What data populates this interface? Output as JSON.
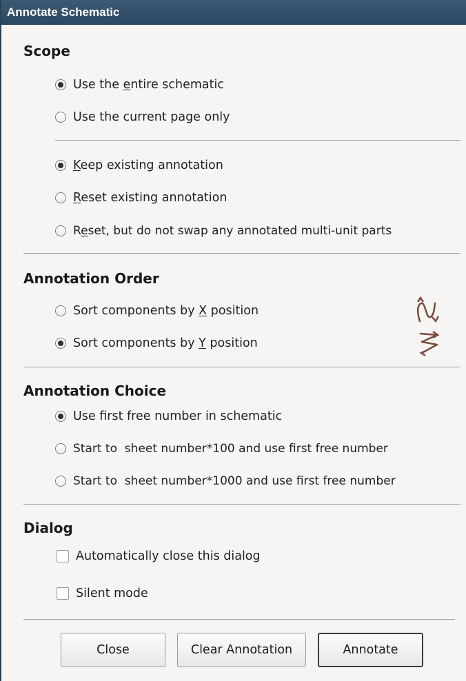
{
  "window": {
    "title": "Annotate Schematic"
  },
  "scope": {
    "title": "Scope",
    "options": [
      {
        "pre": "Use the ",
        "mn": "e",
        "post": "ntire schematic",
        "checked": true
      },
      {
        "pre": "Use the current page only",
        "mn": "",
        "post": "",
        "checked": false
      }
    ],
    "annotation_options": [
      {
        "pre": "",
        "mn": "K",
        "post": "eep existing annotation",
        "checked": true
      },
      {
        "pre": "",
        "mn": "R",
        "post": "eset existing annotation",
        "checked": false
      },
      {
        "pre": "R",
        "mn": "e",
        "post": "set, but do not swap any annotated multi-unit parts",
        "checked": false
      }
    ]
  },
  "order": {
    "title": "Annotation Order",
    "options": [
      {
        "pre": "Sort components by ",
        "mn": "X",
        "post": " position",
        "checked": false,
        "icon": "sort-by-x-icon"
      },
      {
        "pre": "Sort components by ",
        "mn": "Y",
        "post": " position",
        "checked": true,
        "icon": "sort-by-y-icon"
      }
    ]
  },
  "choice": {
    "title": "Annotation Choice",
    "options": [
      {
        "pre": "Use first free number in schematic",
        "mn": "",
        "post": "",
        "checked": true
      },
      {
        "pre": "Start to  sheet number*100 and use first free number",
        "mn": "",
        "post": "",
        "checked": false
      },
      {
        "pre": "Start to  sheet number*1000 and use first free number",
        "mn": "",
        "post": "",
        "checked": false
      }
    ]
  },
  "dialog": {
    "title": "Dialog",
    "auto_close": {
      "label": "Automatically close this dialog",
      "checked": false
    },
    "silent": {
      "label": "Silent mode",
      "checked": false
    }
  },
  "buttons": {
    "close": "Close",
    "clear": "Clear Annotation",
    "annotate": "Annotate"
  },
  "colors": {
    "titlebar": "#2c4760",
    "icon": "#7a4a3a"
  }
}
